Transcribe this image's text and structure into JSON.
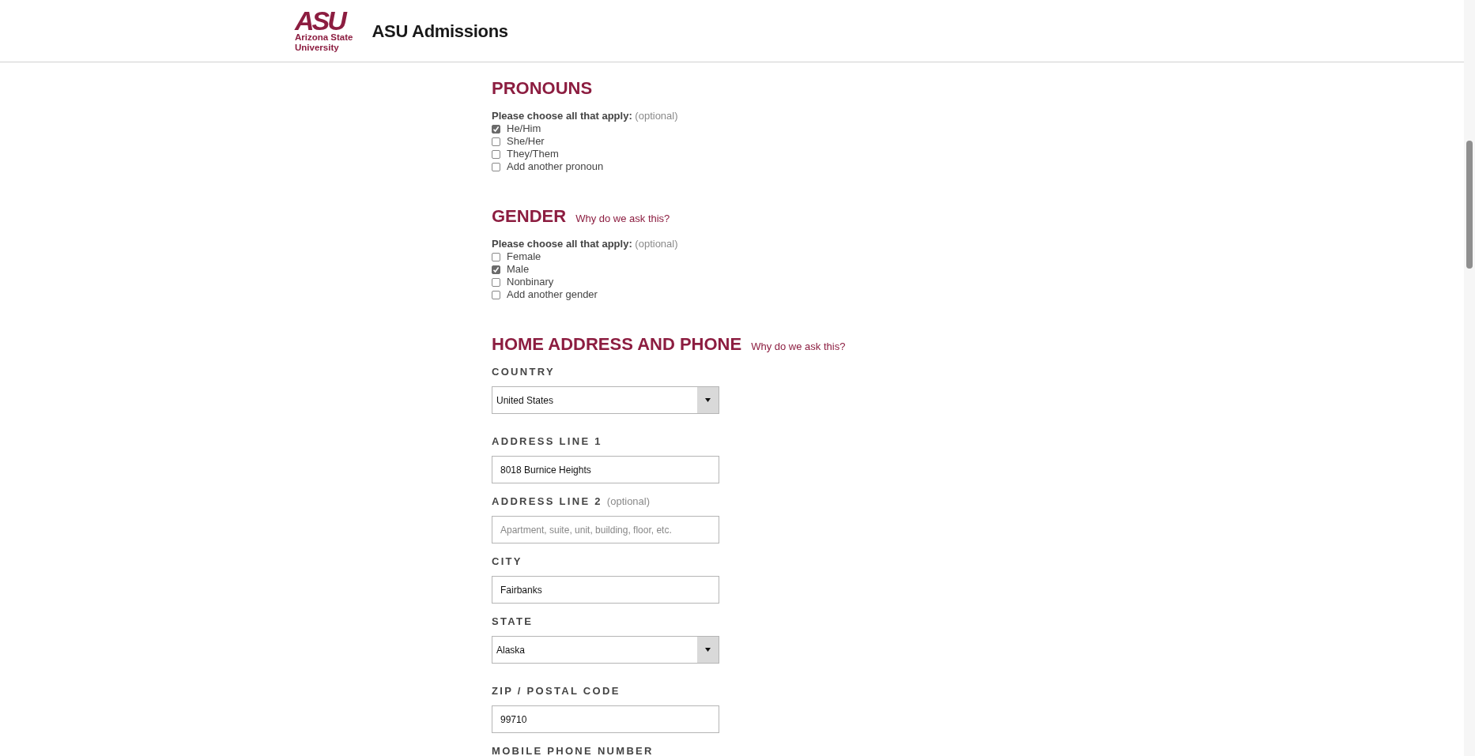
{
  "header": {
    "logo": {
      "mark": "ASU",
      "name_lines": [
        "Arizona State",
        "University"
      ]
    },
    "title": "ASU Admissions"
  },
  "sections": [
    {
      "kind": "checklist",
      "heading": "PRONOUNS",
      "prompt": "Please choose all that apply:",
      "prompt_note": "(optional)",
      "options": [
        {
          "label": "He/Him",
          "checked": true
        },
        {
          "label": "She/Her",
          "checked": false
        },
        {
          "label": "They/Them",
          "checked": false
        },
        {
          "label": "Add another pronoun",
          "checked": false
        }
      ]
    },
    {
      "kind": "checklist",
      "heading": "GENDER",
      "link": "Why do we ask this?",
      "prompt": "Please choose all that apply:",
      "prompt_note": "(optional)",
      "options": [
        {
          "label": "Female",
          "checked": false
        },
        {
          "label": "Male",
          "checked": true
        },
        {
          "label": "Nonbinary",
          "checked": false
        },
        {
          "label": "Add another gender",
          "checked": false
        }
      ]
    },
    {
      "kind": "fields",
      "heading": "HOME ADDRESS AND PHONE",
      "link": "Why do we ask this?",
      "fields": [
        {
          "kind": "select",
          "label": "COUNTRY",
          "value": "United States"
        },
        {
          "kind": "input",
          "label": "ADDRESS LINE 1",
          "value": "8018 Burnice Heights"
        },
        {
          "kind": "input",
          "label": "ADDRESS LINE 2",
          "note": "(optional)",
          "placeholder": "Apartment, suite, unit, building, floor, etc."
        },
        {
          "kind": "input",
          "label": "CITY",
          "value": "Fairbanks"
        },
        {
          "kind": "select",
          "label": "STATE",
          "value": "Alaska"
        },
        {
          "kind": "input",
          "label": "ZIP / POSTAL CODE",
          "value": "99710"
        },
        {
          "kind": "label",
          "label": "MOBILE PHONE NUMBER"
        }
      ]
    }
  ]
}
